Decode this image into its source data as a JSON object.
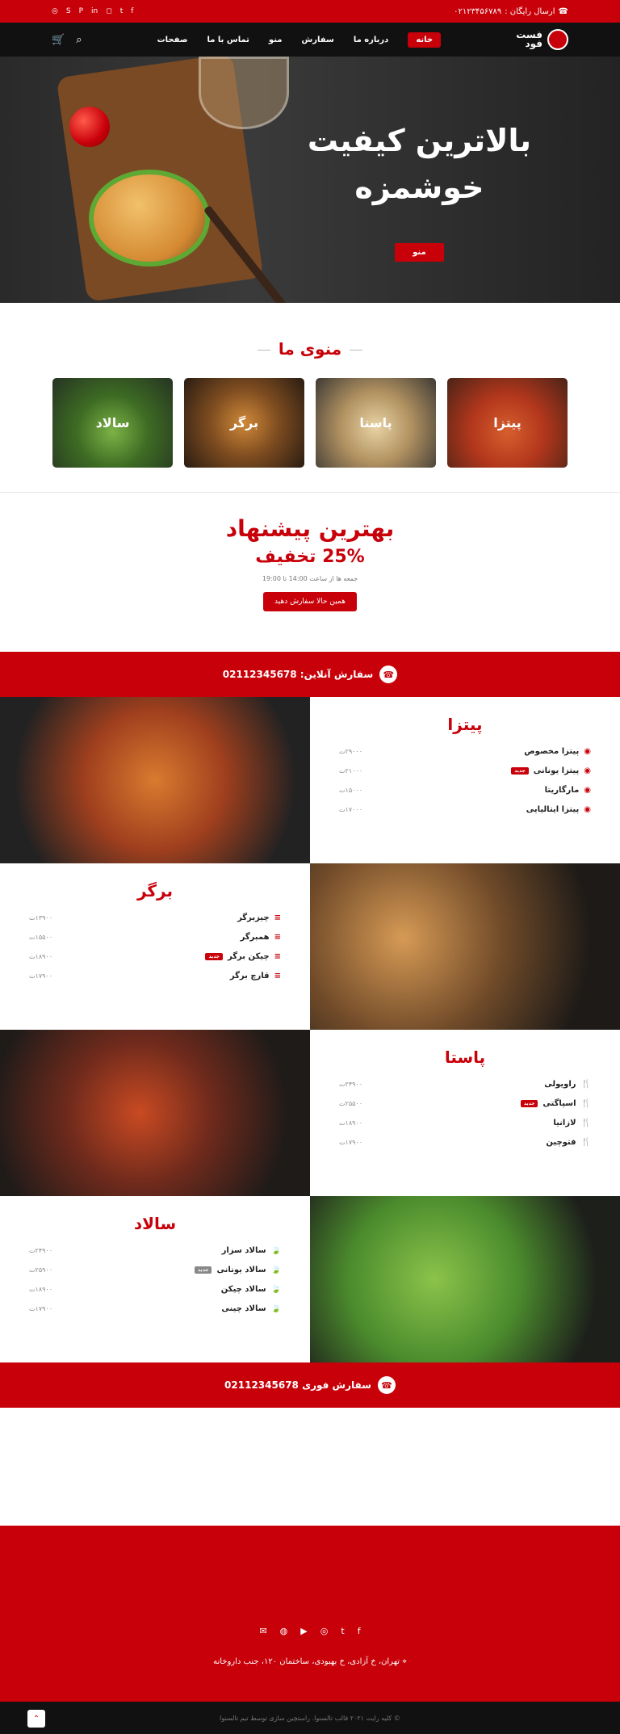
{
  "topbar": {
    "phone_label": "ارسال رایگان :",
    "phone": "۰۲۱۲۳۴۵۶۷۸۹"
  },
  "nav": {
    "logo_line1": "فست",
    "logo_line2": "فود",
    "items": [
      "خانه",
      "درباره ما",
      "سفارش",
      "منو",
      "تماس با ما",
      "صفحات"
    ],
    "active": 0
  },
  "hero": {
    "line1": "بالاترین کیفیت",
    "line2": "خوشمزه",
    "button": "منو"
  },
  "categories": {
    "title": "منوی ما",
    "items": [
      "پیتزا",
      "پاستا",
      "برگر",
      "سالاد"
    ]
  },
  "offer": {
    "title": "بهترین پیشنهاد",
    "discount": "25% تخفیف",
    "time": "جمعه ها از ساعت 14:00 تا 19:00",
    "button": "همین حالا سفارش دهید"
  },
  "bar1": {
    "text": "سفارش آنلاین: 02112345678"
  },
  "sections": [
    {
      "title": "پیتزا",
      "items": [
        {
          "name": "پیتزا مخصوص",
          "price": "۲۹۰۰۰ت"
        },
        {
          "name": "پیتزا یونانی",
          "price": "۲۱۰۰۰ت",
          "badge": "جدید"
        },
        {
          "name": "مارگاریتا",
          "price": "۱۵۰۰۰ت"
        },
        {
          "name": "پیتزا ایتالیایی",
          "price": "۱۷۰۰۰ت"
        }
      ]
    },
    {
      "title": "برگر",
      "items": [
        {
          "name": "چیزبرگر",
          "price": "۱۳۹۰۰ت"
        },
        {
          "name": "همبرگر",
          "price": "۱۵۵۰۰ت"
        },
        {
          "name": "چیکن برگر",
          "price": "۱۸۹۰۰ت",
          "badge": "جدید"
        },
        {
          "name": "قارچ برگر",
          "price": "۱۷۹۰۰ت"
        }
      ]
    },
    {
      "title": "پاستا",
      "items": [
        {
          "name": "راویولی",
          "price": "۲۴۹۰۰ت"
        },
        {
          "name": "اسپاگتی",
          "price": "۲۵۵۰۰ت",
          "badge": "جدید"
        },
        {
          "name": "لازانیا",
          "price": "۱۸۹۰۰ت"
        },
        {
          "name": "فتوچین",
          "price": "۱۷۹۰۰ت"
        }
      ]
    },
    {
      "title": "سالاد",
      "items": [
        {
          "name": "سالاد سزار",
          "price": "۲۴۹۰۰ت"
        },
        {
          "name": "سالاد یونانی",
          "price": "۲۵۹۰۰ت",
          "badge": "جدید"
        },
        {
          "name": "سالاد چیکن",
          "price": "۱۸۹۰۰ت"
        },
        {
          "name": "سالاد چینی",
          "price": "۱۷۹۰۰ت"
        }
      ]
    }
  ],
  "bar2": {
    "text": "سفارش فوری 02112345678"
  },
  "footer": {
    "address": "تهران، خ آزادی، خ بهبودی، ساختمان ۱۲۰، جنب داروخانه",
    "copyright": "© کلیه رایت ۲۰۲۱ قالب تالسنوا. راستچین سازی توسط تیم تالسنوا"
  }
}
